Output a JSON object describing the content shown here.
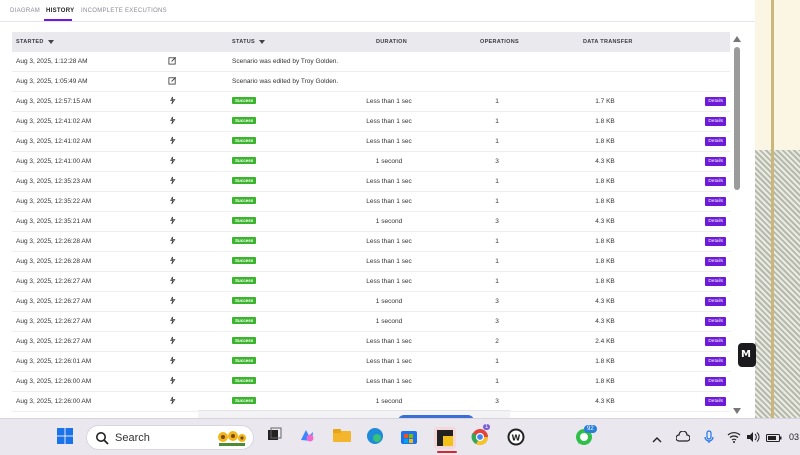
{
  "tabs": [
    {
      "label": "DIAGRAM",
      "active": false
    },
    {
      "label": "HISTORY",
      "active": true
    },
    {
      "label": "INCOMPLETE EXECUTIONS",
      "active": false
    }
  ],
  "table": {
    "headers": {
      "started": "STARTED",
      "status": "STATUS",
      "duration": "DURATION",
      "operations": "OPERATIONS",
      "data_transfer": "DATA TRANSFER"
    },
    "details_label": "Details",
    "rows": [
      {
        "started": "Aug 3, 2025, 1:12:28 AM",
        "icon": "edit-icon",
        "status": "Scenario was edited by Troy Golden.",
        "duration": "",
        "operations": "",
        "data": "",
        "details": false
      },
      {
        "started": "Aug 3, 2025, 1:05:49 AM",
        "icon": "edit-icon",
        "status": "Scenario was edited by Troy Golden.",
        "duration": "",
        "operations": "",
        "data": "",
        "details": false
      },
      {
        "started": "Aug 3, 2025, 12:57:15 AM",
        "icon": "run-icon",
        "status": "Success",
        "duration": "Less than 1 sec",
        "operations": "1",
        "data": "1.7 KB",
        "details": true
      },
      {
        "started": "Aug 3, 2025, 12:41:02 AM",
        "icon": "run-icon",
        "status": "Success",
        "duration": "Less than 1 sec",
        "operations": "1",
        "data": "1.8 KB",
        "details": true
      },
      {
        "started": "Aug 3, 2025, 12:41:02 AM",
        "icon": "run-icon",
        "status": "Success",
        "duration": "Less than 1 sec",
        "operations": "1",
        "data": "1.8 KB",
        "details": true
      },
      {
        "started": "Aug 3, 2025, 12:41:00 AM",
        "icon": "run-icon",
        "status": "Success",
        "duration": "1 second",
        "operations": "3",
        "data": "4.3 KB",
        "details": true
      },
      {
        "started": "Aug 3, 2025, 12:35:23 AM",
        "icon": "run-icon",
        "status": "Success",
        "duration": "Less than 1 sec",
        "operations": "1",
        "data": "1.8 KB",
        "details": true
      },
      {
        "started": "Aug 3, 2025, 12:35:22 AM",
        "icon": "run-icon",
        "status": "Success",
        "duration": "Less than 1 sec",
        "operations": "1",
        "data": "1.8 KB",
        "details": true
      },
      {
        "started": "Aug 3, 2025, 12:35:21 AM",
        "icon": "run-icon",
        "status": "Success",
        "duration": "1 second",
        "operations": "3",
        "data": "4.3 KB",
        "details": true
      },
      {
        "started": "Aug 3, 2025, 12:26:28 AM",
        "icon": "run-icon",
        "status": "Success",
        "duration": "Less than 1 sec",
        "operations": "1",
        "data": "1.8 KB",
        "details": true
      },
      {
        "started": "Aug 3, 2025, 12:26:28 AM",
        "icon": "run-icon",
        "status": "Success",
        "duration": "Less than 1 sec",
        "operations": "1",
        "data": "1.8 KB",
        "details": true
      },
      {
        "started": "Aug 3, 2025, 12:26:27 AM",
        "icon": "run-icon",
        "status": "Success",
        "duration": "Less than 1 sec",
        "operations": "1",
        "data": "1.8 KB",
        "details": true
      },
      {
        "started": "Aug 3, 2025, 12:26:27 AM",
        "icon": "run-icon",
        "status": "Success",
        "duration": "1 second",
        "operations": "3",
        "data": "4.3 KB",
        "details": true
      },
      {
        "started": "Aug 3, 2025, 12:26:27 AM",
        "icon": "run-icon",
        "status": "Success",
        "duration": "1 second",
        "operations": "3",
        "data": "4.3 KB",
        "details": true
      },
      {
        "started": "Aug 3, 2025, 12:26:27 AM",
        "icon": "run-icon",
        "status": "Success",
        "duration": "Less than 1 sec",
        "operations": "2",
        "data": "2.4 KB",
        "details": true
      },
      {
        "started": "Aug 3, 2025, 12:26:01 AM",
        "icon": "run-icon",
        "status": "Success",
        "duration": "Less than 1 sec",
        "operations": "1",
        "data": "1.8 KB",
        "details": true
      },
      {
        "started": "Aug 3, 2025, 12:26:00 AM",
        "icon": "run-icon",
        "status": "Success",
        "duration": "Less than 1 sec",
        "operations": "1",
        "data": "1.8 KB",
        "details": true
      },
      {
        "started": "Aug 3, 2025, 12:26:00 AM",
        "icon": "run-icon",
        "status": "Success",
        "duration": "1 second",
        "operations": "3",
        "data": "4.3 KB",
        "details": true
      }
    ]
  },
  "side_widget": {
    "glyph": "M"
  },
  "taskbar": {
    "search_label": "Search",
    "whatsapp_badge": "92",
    "chrome_badge": "1",
    "clock_partial": "03"
  },
  "colors": {
    "accent": "#6d1ad9",
    "success": "#3bb52d"
  }
}
